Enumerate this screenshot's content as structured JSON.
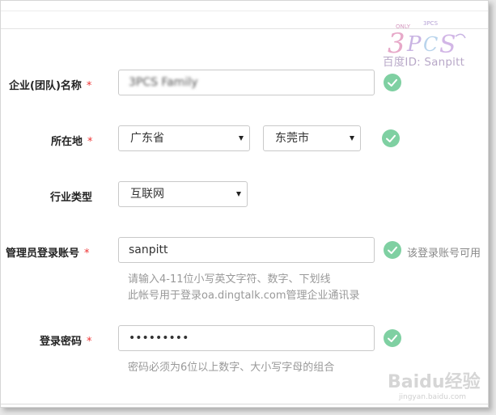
{
  "watermark": {
    "text": "百度ID: Sanpitt",
    "logo": "3PCS"
  },
  "form": {
    "company": {
      "label": "企业(团队)名称",
      "required": "*",
      "value": "3PCS Family"
    },
    "location": {
      "label": "所在地",
      "required": "*",
      "province": "广东省",
      "city": "东莞市"
    },
    "industry": {
      "label": "行业类型",
      "value": "互联网"
    },
    "admin": {
      "label": "管理员登录账号",
      "required": "*",
      "value": "sanpitt",
      "status": "该登录账号可用",
      "hint1": "请输入4-11位小写英文字符、数字、下划线",
      "hint2": "此帐号用于登录oa.dingtalk.com管理企业通讯录"
    },
    "password": {
      "label": "登录密码",
      "required": "*",
      "value": "•••••••••",
      "hint": "密码必须为6位以上数字、大小写字母的组合"
    }
  },
  "footer_watermark": {
    "brand": "Baidu经验",
    "url": "jingyan.baidu.com"
  },
  "colors": {
    "check": "#7fd0a2",
    "required": "#e33333"
  }
}
